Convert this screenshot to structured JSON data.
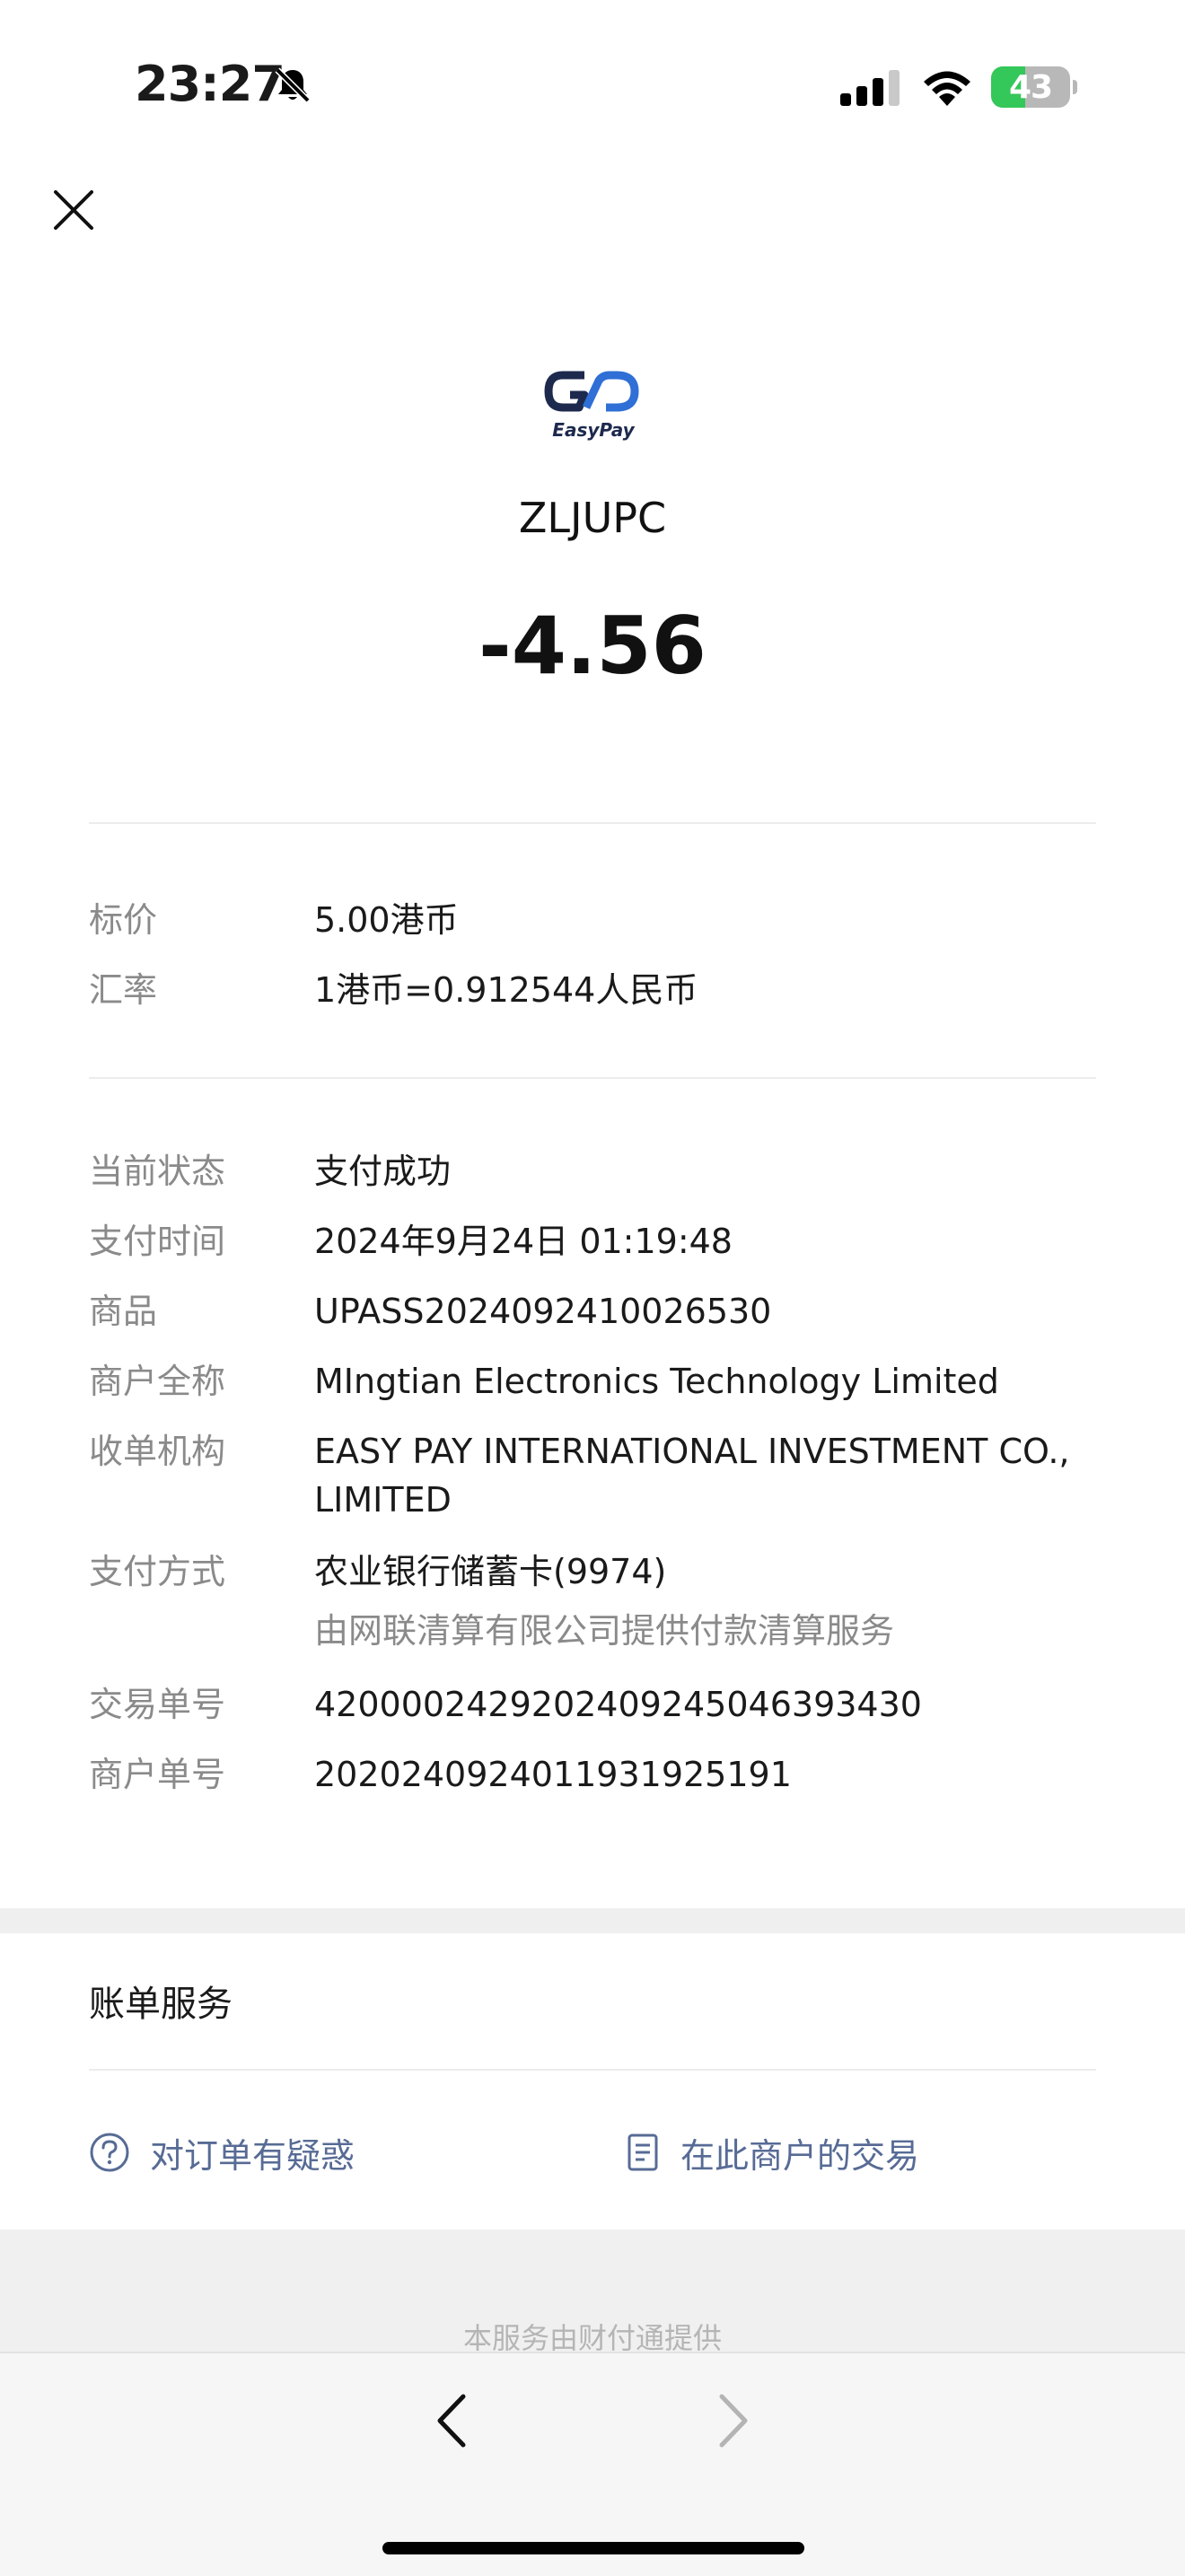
{
  "status_bar": {
    "time": "23:27",
    "battery": "43",
    "battery_level": 0.43
  },
  "merchant": {
    "logo_text": "EasyPay",
    "name": "ZLJUPC",
    "amount": "-4.56"
  },
  "price_info": [
    {
      "label": "标价",
      "value": "5.00港币"
    },
    {
      "label": "汇率",
      "value": "1港币=0.912544人民币"
    }
  ],
  "details": [
    {
      "label": "当前状态",
      "value": "支付成功"
    },
    {
      "label": "支付时间",
      "value": "2024年9月24日 01:19:48"
    },
    {
      "label": "商品",
      "value": "UPASS2024092410026530"
    },
    {
      "label": "商户全称",
      "value": "MIngtian Electronics Technology Limited"
    },
    {
      "label": "收单机构",
      "value": "EASY PAY INTERNATIONAL INVESTMENT CO., LIMITED"
    },
    {
      "label": "支付方式",
      "value": "农业银行储蓄卡(9974)",
      "sub": "由网联清算有限公司提供付款清算服务"
    },
    {
      "label": "交易单号",
      "value": "4200002429202409245046393430"
    },
    {
      "label": "商户单号",
      "value": "2020240924011931925191"
    }
  ],
  "bill_service": {
    "title": "账单服务",
    "links": [
      {
        "label": "对订单有疑惑",
        "icon": "question-circle-icon"
      },
      {
        "label": "在此商户的交易",
        "icon": "document-icon"
      }
    ]
  },
  "footer": {
    "note": "本服务由财付通提供"
  },
  "colors": {
    "link": "#576b95",
    "label": "#8a8a8a",
    "battery_green": "#34c759"
  }
}
